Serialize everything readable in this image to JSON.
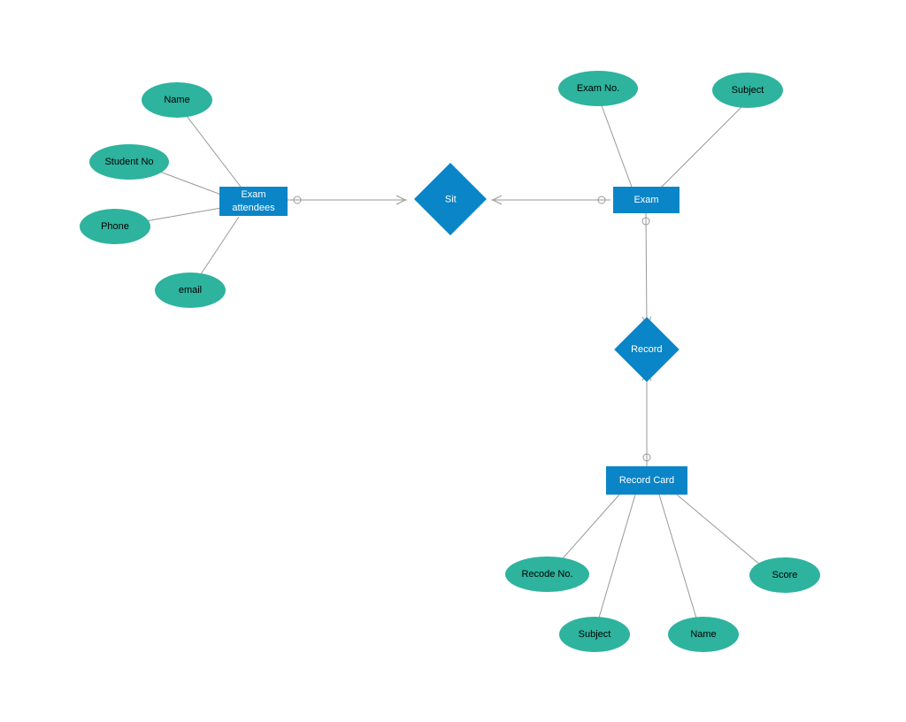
{
  "entities": {
    "examAttendees": "Exam attendees",
    "exam": "Exam",
    "recordCard": "Record Card"
  },
  "relationships": {
    "sit": "Sit",
    "record": "Record"
  },
  "attributes": {
    "name1": "Name",
    "studentNo": "Student No",
    "phone": "Phone",
    "email": "email",
    "examNo": "Exam No.",
    "subject1": "Subject",
    "recodeNo": "Recode No.",
    "subject2": "Subject",
    "name2": "Name",
    "score": "Score"
  }
}
